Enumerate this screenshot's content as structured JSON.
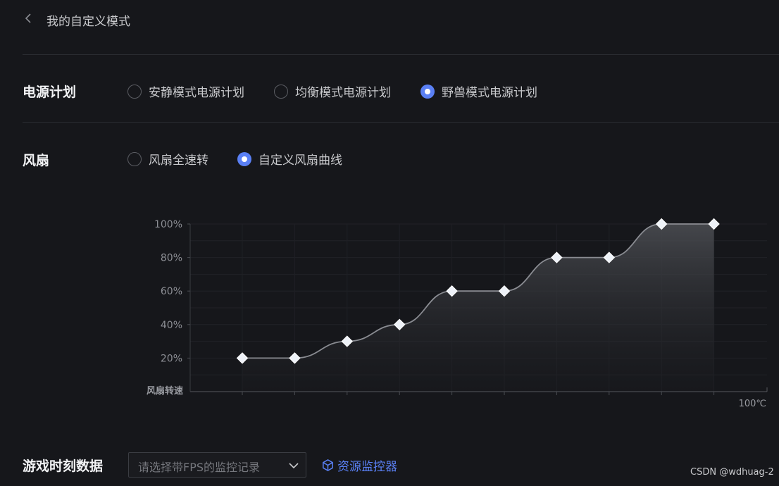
{
  "header": {
    "title": "我的自定义模式",
    "back_icon": "chevron-left-icon"
  },
  "power_plan": {
    "label": "电源计划",
    "options": [
      {
        "label": "安静模式电源计划",
        "selected": false
      },
      {
        "label": "均衡模式电源计划",
        "selected": false
      },
      {
        "label": "野兽模式电源计划",
        "selected": true
      }
    ]
  },
  "fan": {
    "label": "风扇",
    "options": [
      {
        "label": "风扇全速转",
        "selected": false
      },
      {
        "label": "自定义风扇曲线",
        "selected": true
      }
    ]
  },
  "chart_data": {
    "type": "area",
    "y_axis_label": "风扇转速",
    "x_axis_end_label": "100℃",
    "y_ticks": [
      "20%",
      "40%",
      "60%",
      "80%",
      "100%"
    ],
    "ylim": [
      0,
      100
    ],
    "points": [
      20,
      20,
      30,
      40,
      60,
      60,
      80,
      80,
      100,
      100
    ],
    "point_marker": "diamond",
    "grid": true,
    "colors": {
      "line": "#8a8c92",
      "fill_top": "#4a4c51",
      "marker": "#eef2f8"
    }
  },
  "game_data": {
    "label": "游戏时刻数据",
    "select_placeholder": "请选择带FPS的监控记录",
    "chevron_icon": "chevron-down-icon",
    "link_label": "资源监控器",
    "link_icon": "cube-icon"
  },
  "watermark": "CSDN @wdhuag-2",
  "colors": {
    "accent": "#5a80f5",
    "background": "#16171b"
  }
}
